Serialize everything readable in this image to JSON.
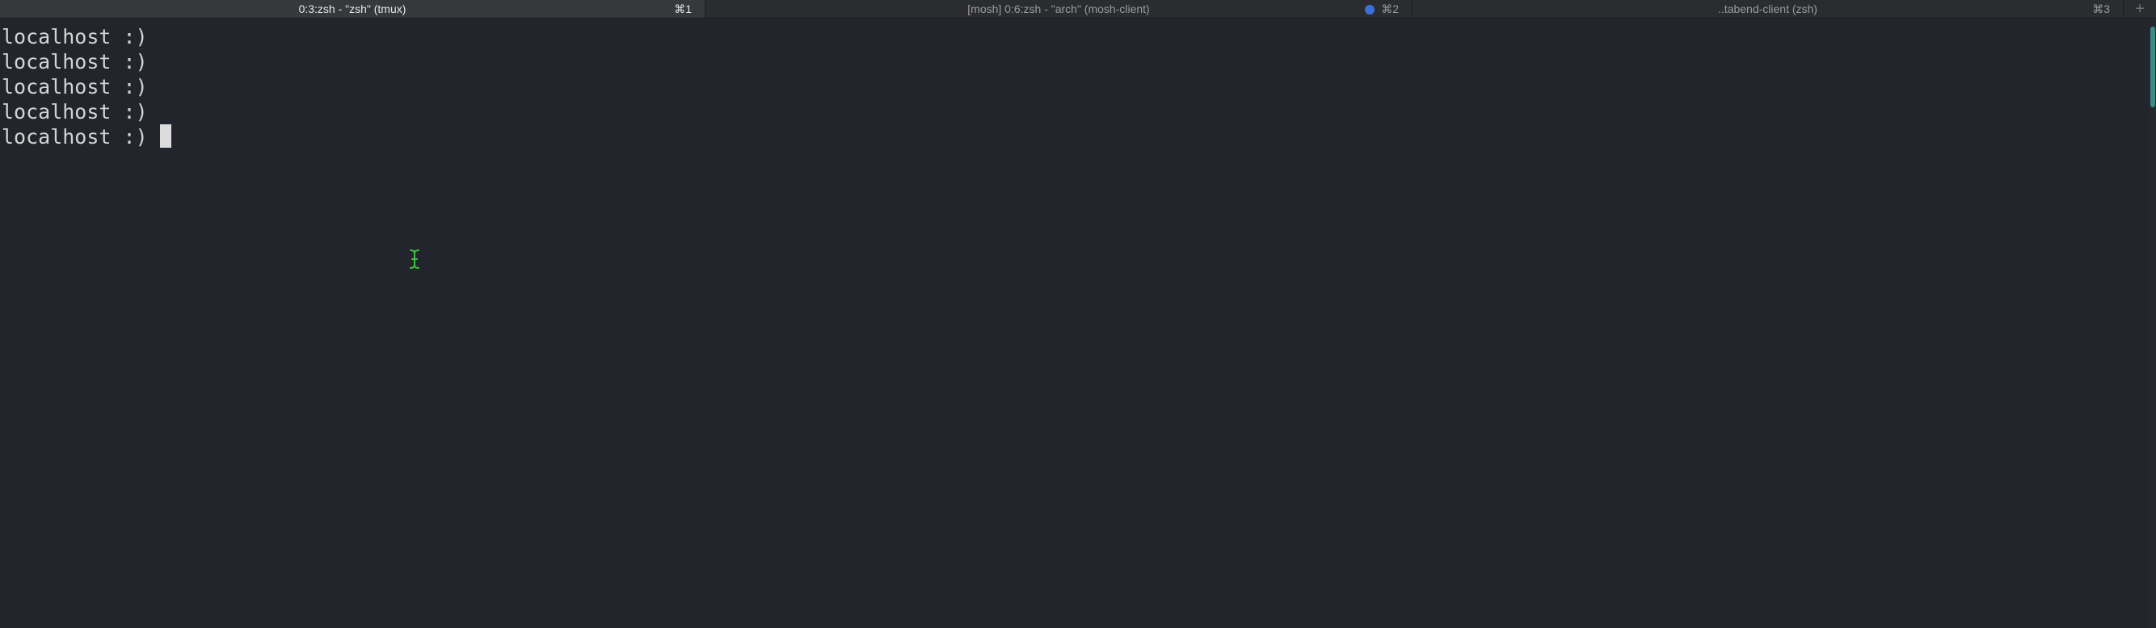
{
  "tabs": [
    {
      "title": "0:3:zsh - \"zsh\" (tmux)",
      "shortcut": "⌘1",
      "active": true
    },
    {
      "title": "[mosh] 0:6:zsh - \"arch\" (mosh-client)",
      "shortcut": "⌘2",
      "active": false,
      "activity_dot_color": "#3b6fdb"
    },
    {
      "title": "..tabend-client (zsh)",
      "shortcut": "⌘3",
      "active": false
    }
  ],
  "new_tab_label": "+",
  "terminal": {
    "lines": [
      "localhost :)",
      "localhost :)",
      "localhost :)",
      "localhost :)",
      "localhost :)"
    ],
    "mouse_pointer": "i-beam-cursor-icon"
  },
  "colors": {
    "background": "#23252c",
    "text": "#d4d4d4",
    "active_tab_text": "#e6e6e6",
    "inactive_tab_text": "#9a9b9e",
    "ibeam": "#3fbf3f",
    "scroll_thumb": "#3a8c84"
  }
}
